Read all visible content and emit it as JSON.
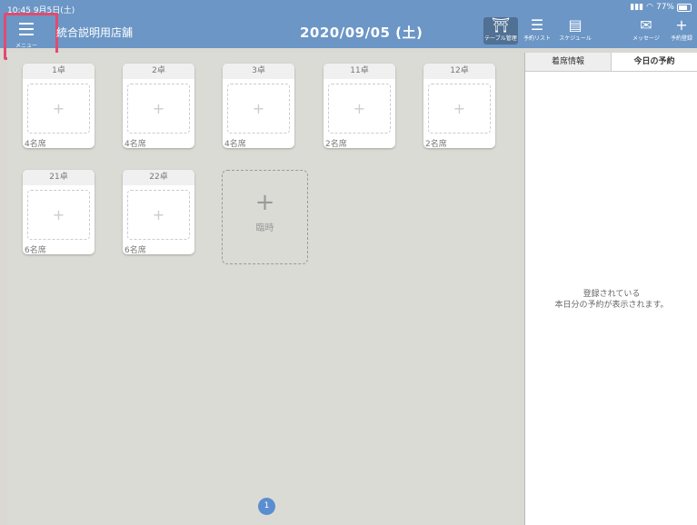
{
  "status": {
    "time": "10:45",
    "date": "9月5日(土)",
    "battery": "77%"
  },
  "header": {
    "menu_label": "メニュー",
    "store_name": "統合説明用店舗",
    "date": "2020/09/05 (土)",
    "buttons": [
      {
        "label": "テーブル管理",
        "icon": "⛩",
        "active": true
      },
      {
        "label": "予約リスト",
        "icon": "☰"
      },
      {
        "label": "スケジュール",
        "icon": "▤"
      },
      {
        "label": "メッセージ",
        "icon": "✉"
      },
      {
        "label": "予約登録",
        "icon": "+"
      }
    ]
  },
  "tables": [
    {
      "name": "1卓",
      "seats": "4名席"
    },
    {
      "name": "2卓",
      "seats": "4名席"
    },
    {
      "name": "3卓",
      "seats": "4名席"
    },
    {
      "name": "11卓",
      "seats": "2名席"
    },
    {
      "name": "12卓",
      "seats": "2名席"
    },
    {
      "name": "21卓",
      "seats": "6名席"
    },
    {
      "name": "22卓",
      "seats": "6名席"
    }
  ],
  "temp_table": {
    "label": "臨時",
    "plus": "+"
  },
  "slot_plus": "+",
  "pagination": {
    "current": "1"
  },
  "side_panel": {
    "tabs": [
      "着席情報",
      "今日の予約"
    ],
    "active_tab": 1,
    "message_line1": "登録されている",
    "message_line2": "本日分の予約が表示されます。"
  }
}
